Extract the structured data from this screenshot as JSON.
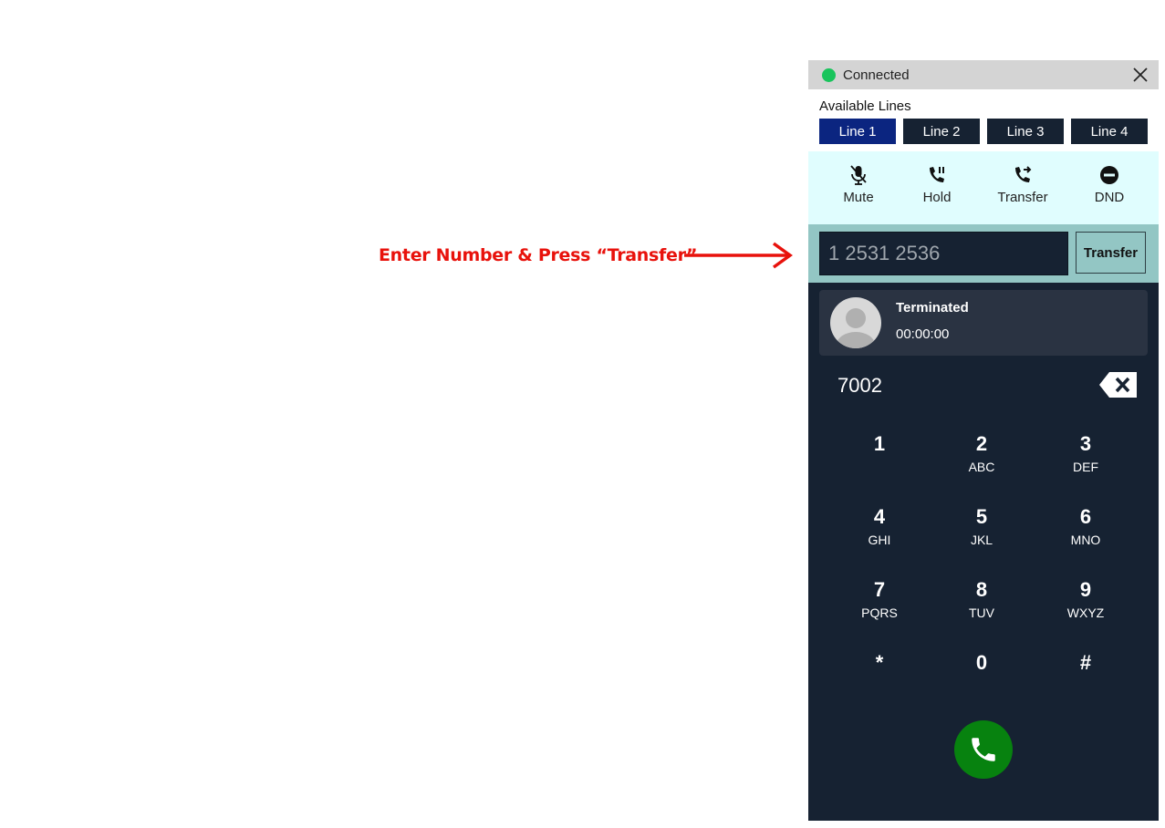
{
  "annotation": {
    "text": "Enter Number & Press “Transfer”",
    "color": "#e8120c"
  },
  "status": {
    "label": "Connected",
    "indicator_color": "#19c45c",
    "close_icon": "close-icon"
  },
  "lines": {
    "label": "Available Lines",
    "items": [
      {
        "label": "Line 1",
        "active": true
      },
      {
        "label": "Line 2",
        "active": false
      },
      {
        "label": "Line 3",
        "active": false
      },
      {
        "label": "Line 4",
        "active": false
      }
    ]
  },
  "controls": [
    {
      "label": "Mute",
      "icon": "microphone-off-icon"
    },
    {
      "label": "Hold",
      "icon": "phone-hold-icon"
    },
    {
      "label": "Transfer",
      "icon": "phone-forward-icon"
    },
    {
      "label": "DND",
      "icon": "do-not-disturb-icon"
    }
  ],
  "transfer": {
    "input_value": "1 2531 2536",
    "button_label": "Transfer"
  },
  "call": {
    "status": "Terminated",
    "duration": "00:00:00",
    "avatar_icon": "user-avatar-icon"
  },
  "dialer": {
    "value": "7002",
    "backspace_icon": "backspace-icon",
    "keys": [
      {
        "digit": "1",
        "letters": ""
      },
      {
        "digit": "2",
        "letters": "ABC"
      },
      {
        "digit": "3",
        "letters": "DEF"
      },
      {
        "digit": "4",
        "letters": "GHI"
      },
      {
        "digit": "5",
        "letters": "JKL"
      },
      {
        "digit": "6",
        "letters": "MNO"
      },
      {
        "digit": "7",
        "letters": "PQRS"
      },
      {
        "digit": "8",
        "letters": "TUV"
      },
      {
        "digit": "9",
        "letters": "WXYZ"
      },
      {
        "digit": "*",
        "letters": ""
      },
      {
        "digit": "0",
        "letters": ""
      },
      {
        "digit": "#",
        "letters": ""
      }
    ],
    "call_icon": "phone-call-icon",
    "call_color": "#07820f"
  },
  "colors": {
    "panel": "#162232",
    "active_line": "#0b2580",
    "controls_bg": "#e0fdfe",
    "transfer_bg": "#93c6c4"
  }
}
